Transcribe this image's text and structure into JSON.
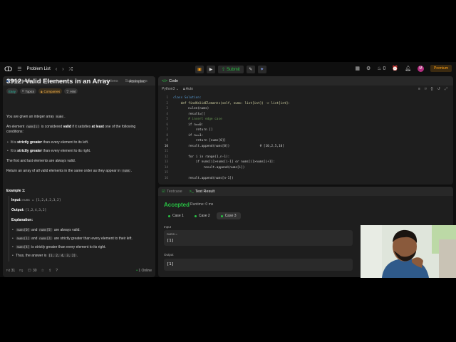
{
  "topbar": {
    "problem_list": "Problem List",
    "submit": "Submit",
    "fire_count": "0",
    "avatar_letter": "M",
    "premium": "Premium"
  },
  "left": {
    "tabs": [
      "Description",
      "Wrong Answer",
      "Editorial",
      "Solutions",
      "Submissions"
    ],
    "title": "3912. Valid Elements in an Array",
    "status": "Attempted",
    "chips": [
      "Easy",
      "Topics",
      "Companies",
      "Hint"
    ],
    "p1_a": "You are given an integer array ",
    "p1_code": "nums",
    "p1_b": ".",
    "p2_a": "An element ",
    "p2_code": "nums[i]",
    "p2_b": " is considered ",
    "p2_valid": "valid",
    "p2_c": " if it satisfies ",
    "p2_atleast": "at least",
    "p2_d": " one of the following conditions:",
    "b1_a": "It is ",
    "b1_bold": "strictly greater",
    "b1_b": " than every element to its left.",
    "b2_a": "It is ",
    "b2_bold": "strictly greater",
    "b2_b": " than every element to its right.",
    "p3": "The first and last elements are always valid.",
    "p4_a": "Return an array of all valid elements in the same order as they appear in ",
    "p4_code": "nums",
    "p4_b": ".",
    "example_title": "Example 1:",
    "input_label": "Input:",
    "input_value": "nums = [1,2,4,2,3,2]",
    "output_label": "Output:",
    "output_value": "[1,2,4,3,2]",
    "explanation": "Explanation:",
    "e1_c1": "nums[0]",
    "e1_a": " and ",
    "e1_c2": "nums[5]",
    "e1_b": " are always valid.",
    "e2_c1": "nums[1]",
    "e2_a": " and ",
    "e2_c2": "nums[2]",
    "e2_b": " are strictly greater than every element to their left.",
    "e3_c1": "nums[4]",
    "e3_b": " is strictly greater than every element to its right.",
    "e4_a": "Thus, the answer is ",
    "e4_code": "[1, 2, 4, 3, 2]",
    "e4_b": ".",
    "likes": "31",
    "comments": "30",
    "online": "1 Online"
  },
  "code_panel": {
    "title": "Code",
    "language": "Python3",
    "auto": "Auto",
    "lines": [
      "class Solution:",
      "    def findValidElements(self, nums: list[int]) -> list[int]:",
      "        n=len(nums)",
      "        result=[]",
      "        # insert edge case",
      "        if n==0:",
      "            return []",
      "        if n==1:",
      "            return [nums[0]]",
      "        result.append(nums[0])                # [10,2,5,10]",
      "",
      "        for i in range(1,n-1):",
      "            if nums[i]>nums[i-1] or nums[i]>nums[i+1]:",
      "                result.append(nums[i])",
      "",
      "        result.append(nums[n-1])"
    ]
  },
  "result_panel": {
    "tabs": [
      "Testcase",
      "Test Result"
    ],
    "status": "Accepted",
    "runtime": "Runtime: 0 ms",
    "cases": [
      "Case 1",
      "Case 2",
      "Case 3"
    ],
    "input_label": "Input",
    "param_label": "nums =",
    "param_value": "[1]",
    "output_label": "Output",
    "output_value": "[1]"
  },
  "colors": {
    "accent_green": "#28c244",
    "premium_orange": "#ffa116",
    "tab_blue": "#3e8bff"
  }
}
